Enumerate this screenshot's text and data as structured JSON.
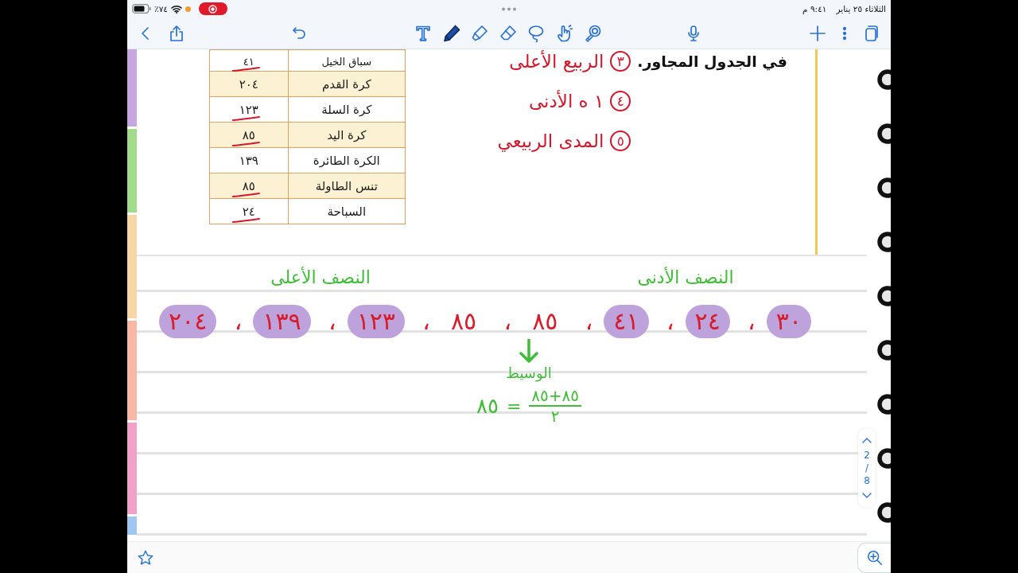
{
  "status_bar": {
    "battery": "٧٤٪",
    "time": "٩:٤١ م",
    "date": "الثلاثاء ٢٥ يناير"
  },
  "toolbar": {
    "tools": [
      {
        "kind": "text",
        "selected": false
      },
      {
        "kind": "pen",
        "selected": true
      },
      {
        "kind": "highlighter",
        "selected": false
      },
      {
        "kind": "eraser",
        "selected": false
      },
      {
        "kind": "lasso",
        "selected": false
      },
      {
        "kind": "hand",
        "selected": false
      },
      {
        "kind": "laser",
        "selected": false
      }
    ]
  },
  "page": {
    "table": {
      "rows": [
        {
          "sport": "سباق الخيل",
          "value": "٤١",
          "crossed_out": true
        },
        {
          "sport": "كرة القدم",
          "value": "٢٠٤",
          "crossed_out": false
        },
        {
          "sport": "كرة السلة",
          "value": "١٢٣",
          "crossed_out": true
        },
        {
          "sport": "كرة اليد",
          "value": "٨٥",
          "crossed_out": true
        },
        {
          "sport": "الكرة الطائرة",
          "value": "١٣٩",
          "crossed_out": false
        },
        {
          "sport": "تنس الطاولة",
          "value": "٨٥",
          "crossed_out": true
        },
        {
          "sport": "السباحة",
          "value": "٢٤",
          "crossed_out": true
        }
      ]
    },
    "intro_text": "في الجدول المجاور.",
    "notes": [
      {
        "number": "٣",
        "text": "الربيع الأعلى"
      },
      {
        "number": "٤",
        "text": "١ ه الأدنى"
      },
      {
        "number": "٥",
        "text": "المدى الربيعي"
      }
    ],
    "half_labels": [
      "النصف الأدنى",
      "النصف الأعلى"
    ],
    "ordered_values": [
      {
        "number": "٣٠",
        "highlighted": true,
        "comma": "،"
      },
      {
        "number": "٢٤",
        "highlighted": true,
        "comma": "،"
      },
      {
        "number": "٤١",
        "highlighted": true,
        "comma": "،"
      },
      {
        "number": "٨٥",
        "highlighted": false,
        "comma": "،"
      },
      {
        "number": "٨٥",
        "highlighted": false,
        "comma": "،"
      },
      {
        "number": "١٢٣",
        "highlighted": true,
        "comma": "،"
      },
      {
        "number": "١٣٩",
        "highlighted": true,
        "comma": "،"
      },
      {
        "number": "٢٠٤",
        "highlighted": true
      }
    ],
    "median": {
      "label": "الوسيط",
      "numerator": "٨٥+٨٥",
      "denominator": "٢",
      "equals": "=",
      "result": "٨٥"
    }
  },
  "page_indicator": {
    "current": "2",
    "separator": "/",
    "total": "8"
  }
}
